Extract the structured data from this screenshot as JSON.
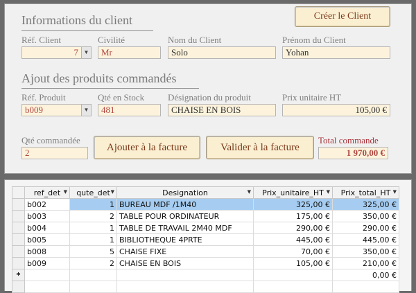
{
  "client_section": {
    "title": "Informations du client",
    "create_button": "Créer le Client",
    "ref_label": "Réf. Client",
    "ref_value": "7",
    "civilite_label": "Civilité",
    "civilite_value": "Mr",
    "nom_label": "Nom du Client",
    "nom_value": "Solo",
    "prenom_label": "Prénom du Client",
    "prenom_value": "Yohan"
  },
  "product_section": {
    "title": "Ajout des produits commandés",
    "ref_label": "Réf. Produit",
    "ref_value": "b009",
    "stock_label": "Qté en Stock",
    "stock_value": "481",
    "designation_label": "Désignation du produit",
    "designation_value": "CHAISE EN BOIS",
    "prix_label": "Prix unitaire HT",
    "prix_value": "105,00 €"
  },
  "order_section": {
    "qte_label": "Qté commandée",
    "qte_value": "2",
    "add_button": "Ajouter à la facture",
    "validate_button": "Valider à la facture",
    "total_label": "Total commande",
    "total_value": "1 970,00 €"
  },
  "grid": {
    "columns": [
      "ref_det",
      "qute_det",
      "Designation",
      "Prix_unitaire_HT",
      "Prix_total_HT"
    ],
    "rows": [
      [
        "b002",
        "1",
        "BUREAU MDF /1M40",
        "325,00 €",
        "325,00 €"
      ],
      [
        "b003",
        "2",
        "TABLE POUR ORDINATEUR",
        "175,00 €",
        "350,00 €"
      ],
      [
        "b004",
        "1",
        "TABLE DE TRAVAIL 2M40 MDF",
        "290,00 €",
        "290,00 €"
      ],
      [
        "b005",
        "1",
        "BIBLIOTHEQUE 4PRTE",
        "445,00 €",
        "445,00 €"
      ],
      [
        "b008",
        "5",
        "CHAISE FIXE",
        "70,00 €",
        "350,00 €"
      ],
      [
        "b009",
        "2",
        "CHAISE EN BOIS",
        "105,00 €",
        "210,00 €"
      ]
    ],
    "new_row_marker": "*",
    "new_row_total": "0,00 €"
  },
  "icons": {
    "combo_arrow": "chevron-down-icon",
    "header_arrow": "sort-arrow-icon"
  }
}
